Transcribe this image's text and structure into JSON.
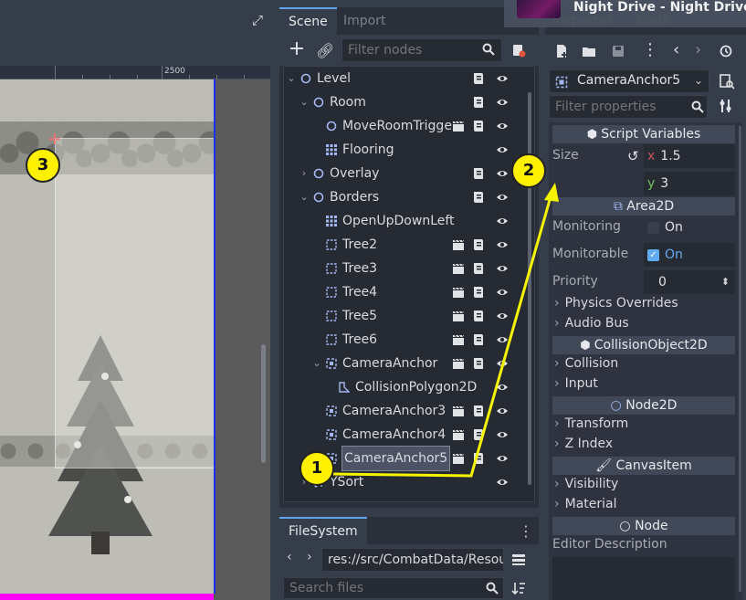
{
  "viewport": {
    "ruler_label": "2500"
  },
  "scene_dock": {
    "tabs": [
      "Scene",
      "Import"
    ],
    "filter_placeholder": "Filter nodes",
    "tree": [
      {
        "label": "Level"
      },
      {
        "label": "Room"
      },
      {
        "label": "MoveRoomTrigge"
      },
      {
        "label": "Flooring"
      },
      {
        "label": "Overlay"
      },
      {
        "label": "Borders"
      },
      {
        "label": "OpenUpDownLeft"
      },
      {
        "label": "Tree2"
      },
      {
        "label": "Tree3"
      },
      {
        "label": "Tree4"
      },
      {
        "label": "Tree5"
      },
      {
        "label": "Tree6"
      },
      {
        "label": "CameraAnchor"
      },
      {
        "label": "CollisionPolygon2D"
      },
      {
        "label": "CameraAnchor3"
      },
      {
        "label": "CameraAnchor4"
      },
      {
        "label": "CameraAnchor5",
        "selected": true
      },
      {
        "label": "YSort"
      }
    ]
  },
  "filesystem": {
    "tab": "FileSystem",
    "path": "res://src/CombatData/Resou",
    "search_placeholder": "Search files"
  },
  "inspector": {
    "tabs": [
      "Inspector",
      "Node"
    ],
    "selected_node": "CameraAnchor5",
    "filter_placeholder": "Filter properties",
    "sections": {
      "script_variables": "Script Variables",
      "area2d": "Area2D",
      "collision_object": "CollisionObject2D",
      "node2d": "Node2D",
      "canvas_item": "CanvasItem",
      "node": "Node"
    },
    "size": {
      "label": "Size",
      "x_label": "x",
      "x_value": "1.5",
      "y_label": "y",
      "y_value": "3"
    },
    "monitoring": {
      "label": "Monitoring",
      "value": "On"
    },
    "monitorable": {
      "label": "Monitorable",
      "value": "On"
    },
    "priority": {
      "label": "Priority",
      "value": "0"
    },
    "groups": {
      "physics_overrides": "Physics Overrides",
      "audio_bus": "Audio Bus",
      "collision": "Collision",
      "input": "Input",
      "transform": "Transform",
      "z_index": "Z Index",
      "visibility": "Visibility",
      "material": "Material"
    },
    "editor_description": "Editor Description"
  },
  "media_overlay": {
    "title": "Night Drive - Night Drive"
  },
  "annotations": [
    "1",
    "2",
    "3"
  ],
  "colors": {
    "accent": "#60a0f0",
    "callout": "#fff100",
    "annotation_line": "#f5f500"
  }
}
